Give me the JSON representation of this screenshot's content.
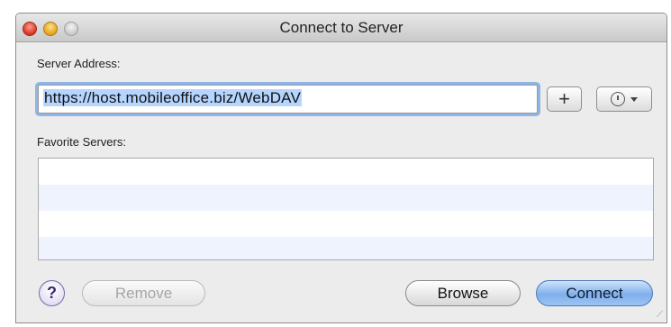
{
  "window": {
    "title": "Connect to Server"
  },
  "labels": {
    "server_address": "Server Address:",
    "favorite_servers": "Favorite Servers:"
  },
  "address": {
    "value": "https://host.mobileoffice.biz/WebDAV"
  },
  "toolbar": {
    "add_label": "+",
    "recent_icon": "clock-icon"
  },
  "favorites": {
    "rows": [
      "",
      "",
      "",
      ""
    ]
  },
  "buttons": {
    "help_label": "?",
    "remove_label": "Remove",
    "browse_label": "Browse",
    "connect_label": "Connect"
  },
  "colors": {
    "focus_ring": "#8fb5e6",
    "default_button": "#7fb0ec",
    "list_alt_row": "#eef3fd"
  }
}
